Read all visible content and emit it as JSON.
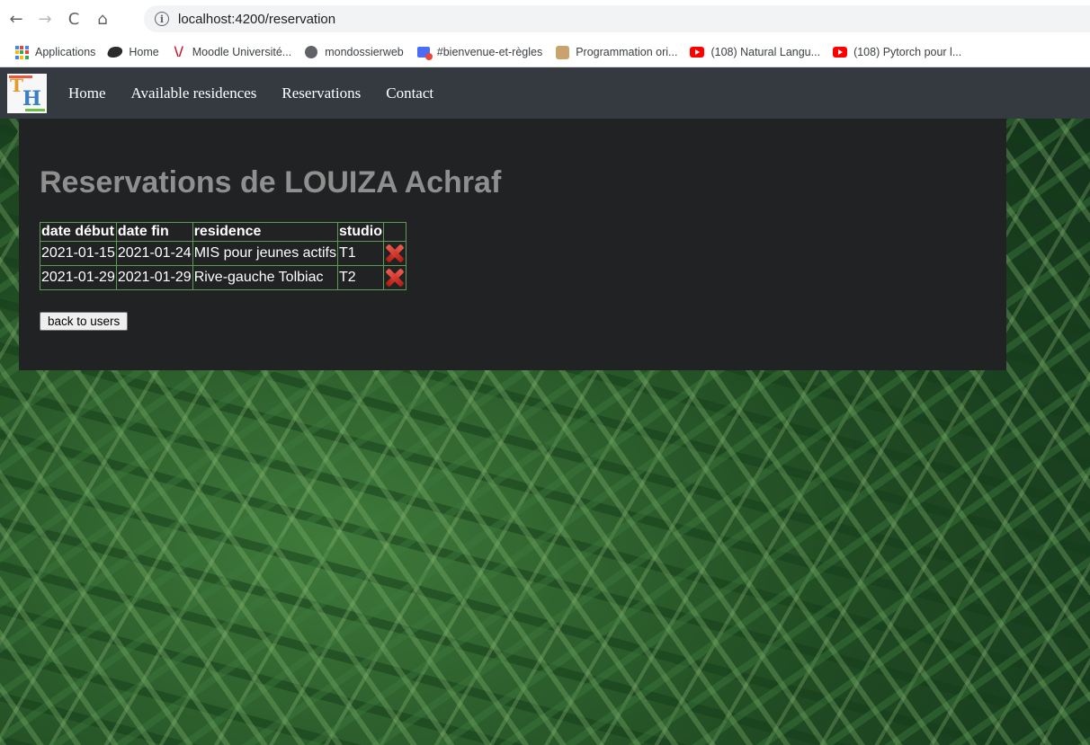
{
  "browser": {
    "url": "localhost:4200/reservation",
    "nav": {
      "back": "←",
      "forward": "→",
      "reload": "C",
      "home": "⌂"
    },
    "bookmarks": [
      {
        "label": "Applications",
        "icon": "apps-grid-icon"
      },
      {
        "label": "Home",
        "icon": "bird-icon"
      },
      {
        "label": "Moodle Université...",
        "icon": "moodle-icon"
      },
      {
        "label": "mondossierweb",
        "icon": "globe-icon"
      },
      {
        "label": "#bienvenue-et-règles",
        "icon": "chat-icon"
      },
      {
        "label": "Programmation ori...",
        "icon": "avatar-icon"
      },
      {
        "label": "(108) Natural Langu...",
        "icon": "youtube-icon"
      },
      {
        "label": "(108) Pytorch pour l...",
        "icon": "youtube-icon"
      }
    ]
  },
  "app": {
    "logo": {
      "t": "T",
      "h": "H"
    },
    "nav": [
      "Home",
      "Available residences",
      "Reservations",
      "Contact"
    ],
    "title": "Reservations de LOUIZA Achraf",
    "table": {
      "headers": [
        "date début",
        "date fin",
        "residence",
        "studio"
      ],
      "rows": [
        [
          "2021-01-15",
          "2021-01-24",
          "MIS pour jeunes actifs",
          "T1"
        ],
        [
          "2021-01-29",
          "2021-01-29",
          "Rive-gauche Tolbiac",
          "T2"
        ]
      ],
      "delete_icon": "delete-x-icon"
    },
    "back_button": "back to users"
  },
  "colors": {
    "navbar": "#343a40",
    "panel": "#202223",
    "title": "#8f8f8f",
    "table_border": "#5c9c52",
    "delete": "#e0392e"
  }
}
